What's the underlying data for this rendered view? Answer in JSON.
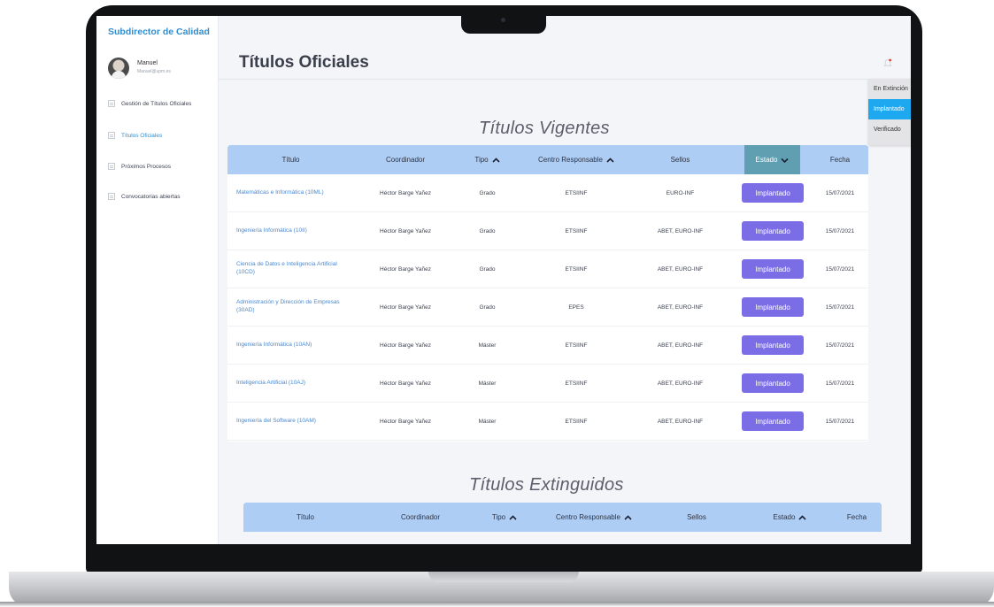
{
  "app": {
    "title": "Subdirector de Calidad"
  },
  "user": {
    "name": "Manuel",
    "email": "Manuel@upm.es"
  },
  "sidebar": {
    "items": [
      {
        "label": "Gestión de Títulos Oficiales",
        "active": false
      },
      {
        "label": "Títulos Oficiales",
        "active": true
      },
      {
        "label": "Próximos Procesos",
        "active": false
      },
      {
        "label": "Convocatorias abiertas",
        "active": false
      }
    ]
  },
  "page": {
    "title": "Títulos Oficiales"
  },
  "vigentes": {
    "title": "Títulos Vigentes",
    "headers": {
      "titulo": "Título",
      "coordinador": "Coordinador",
      "tipo": "Tipo",
      "centro": "Centro Responsable",
      "sellos": "Sellos",
      "estado": "Estado",
      "fecha": "Fecha"
    },
    "rows": [
      {
        "titulo": "Matemáticas e Informática (10ML)",
        "coordinador": "Héctor Barge Yañez",
        "tipo": "Grado",
        "centro": "ETSIINF",
        "sellos": "EURO-INF",
        "estado": "Implantado",
        "fecha": "15/07/2021"
      },
      {
        "titulo": "Ingeniería Informática (10II)",
        "coordinador": "Héctor Barge Yañez",
        "tipo": "Grado",
        "centro": "ETSIINF",
        "sellos": "ABET, EURO-INF",
        "estado": "Implantado",
        "fecha": "15/07/2021"
      },
      {
        "titulo": "Ciencia de Datos e Inteligencia Artificial (10CD)",
        "coordinador": "Héctor Barge Yañez",
        "tipo": "Grado",
        "centro": "ETSIINF",
        "sellos": "ABET, EURO-INF",
        "estado": "Implantado",
        "fecha": "15/07/2021"
      },
      {
        "titulo": "Administración y Dirección de Empresas (30AD)",
        "coordinador": "Héctor Barge Yañez",
        "tipo": "Grado",
        "centro": "EPES",
        "sellos": "ABET, EURO-INF",
        "estado": "Implantado",
        "fecha": "15/07/2021"
      },
      {
        "titulo": "Ingeniería Informática (10AN)",
        "coordinador": "Héctor Barge Yañez",
        "tipo": "Máster",
        "centro": "ETSIINF",
        "sellos": "ABET, EURO-INF",
        "estado": "Implantado",
        "fecha": "15/07/2021"
      },
      {
        "titulo": "Inteligencia Artificial (10AJ)",
        "coordinador": "Héctor Barge Yañez",
        "tipo": "Máster",
        "centro": "ETSIINF",
        "sellos": "ABET, EURO-INF",
        "estado": "Implantado",
        "fecha": "15/07/2021"
      },
      {
        "titulo": "Ingeniería del Software (10AM)",
        "coordinador": "Héctor Barge Yañez",
        "tipo": "Máster",
        "centro": "ETSIINF",
        "sellos": "ABET, EURO-INF",
        "estado": "Implantado",
        "fecha": "15/07/2021"
      }
    ]
  },
  "estado_dropdown": {
    "options": [
      "En Extinción",
      "Implantado",
      "Verificado"
    ],
    "selected": "Implantado"
  },
  "extinguidos": {
    "title": "Títulos Extinguidos",
    "headers": {
      "titulo": "Título",
      "coordinador": "Coordinador",
      "tipo": "Tipo",
      "centro": "Centro Responsable",
      "sellos": "Sellos",
      "estado": "Estado",
      "fecha": "Fecha"
    }
  },
  "colors": {
    "accent": "#2f8ed0",
    "header_row": "#aecdf5",
    "badge": "#7a6de6",
    "dropdown_selected": "#1ea8ef",
    "estado_header": "#5f9fb1"
  },
  "icons": {
    "nav": "list-icon",
    "sort": "chevron-up-icon",
    "estado_sort": "chevron-down-icon",
    "notification": "bell-icon"
  }
}
